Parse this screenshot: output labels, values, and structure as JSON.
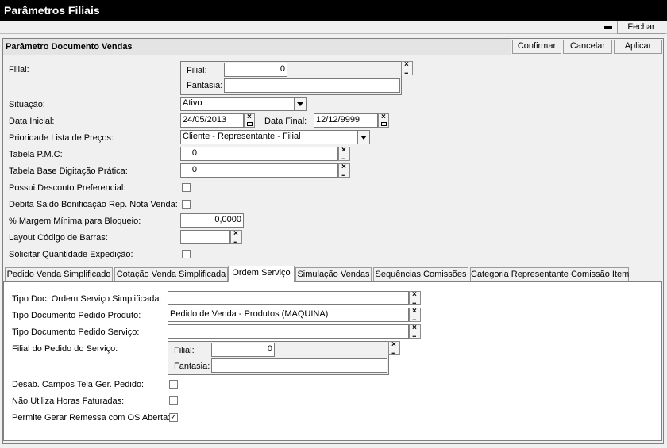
{
  "window": {
    "title": "Parâmetros Filiais",
    "close_label": "Fechar"
  },
  "panel": {
    "title": "Parâmetro Documento Vendas",
    "confirm_label": "Confirmar",
    "cancel_label": "Cancelar",
    "apply_label": "Aplicar"
  },
  "form": {
    "filial_label": "Filial:",
    "filial_sub_label": "Filial:",
    "filial_value": "0",
    "fantasia_label": "Fantasia:",
    "fantasia_value": "",
    "situacao_label": "Situação:",
    "situacao_value": "Ativo",
    "data_inicial_label": "Data Inicial:",
    "data_inicial_value": "24/05/2013",
    "data_final_label": "Data Final:",
    "data_final_value": "12/12/9999",
    "prioridade_label": "Prioridade Lista de Preços:",
    "prioridade_value": "Cliente - Representante - Filial",
    "tabela_pmc_label": "Tabela P.M.C:",
    "tabela_pmc_code": "0",
    "tabela_pmc_desc": "",
    "tabela_base_label": "Tabela Base Digitação Prática:",
    "tabela_base_code": "0",
    "tabela_base_desc": "",
    "possui_desconto_label": "Possui Desconto Preferencial:",
    "debita_saldo_label": "Debita Saldo Bonificação Rep. Nota Venda:",
    "margem_label": "% Margem Mínima para Bloqueio:",
    "margem_value": "0,0000",
    "layout_label": "Layout Código de Barras:",
    "layout_value": "",
    "solicitar_label": "Solicitar Quantidade Expedição:"
  },
  "tabs": [
    {
      "label": "Pedido Venda Simplificado"
    },
    {
      "label": "Cotação Venda Simplificada"
    },
    {
      "label": "Ordem Serviço"
    },
    {
      "label": "Simulação Vendas"
    },
    {
      "label": "Sequências Comissões"
    },
    {
      "label": "Categoria Representante Comissão Item"
    }
  ],
  "ordem_servico": {
    "tipo_doc_os_label": "Tipo Doc. Ordem Serviço Simplificada:",
    "tipo_doc_os_value": "",
    "tipo_doc_produto_label": "Tipo Documento Pedido Produto:",
    "tipo_doc_produto_value": "Pedido de Venda - Produtos (MAQUINA)",
    "tipo_doc_servico_label": "Tipo Documento Pedido Serviço:",
    "tipo_doc_servico_value": "",
    "filial_pedido_label": "Filial do Pedido do Serviço:",
    "filial_sub_label": "Filial:",
    "filial_value": "0",
    "fantasia_label": "Fantasia:",
    "fantasia_value": "",
    "desab_label": "Desab. Campos Tela Ger. Pedido:",
    "nao_utiliza_label": "Não Utiliza Horas Faturadas:",
    "permite_label": "Permite Gerar Remessa com OS Aberta:",
    "permite_checked": "✓"
  }
}
